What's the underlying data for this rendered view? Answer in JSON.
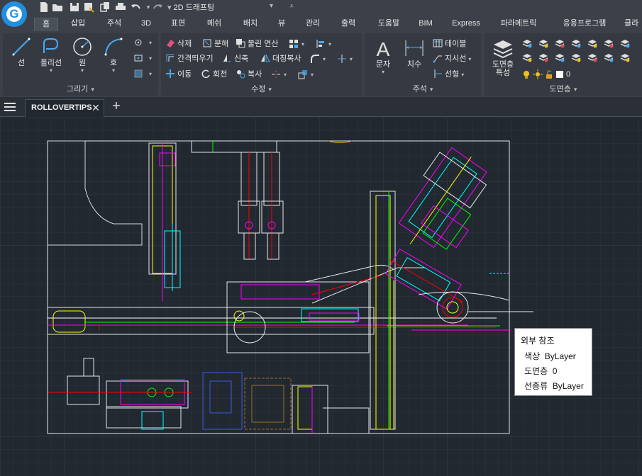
{
  "quick_access": {
    "workspace": "2D 드래프팅",
    "icons": [
      "new-file-icon",
      "open-folder-icon",
      "save-icon",
      "save-as-icon",
      "copy-icon",
      "print-icon",
      "undo-icon",
      "redo-icon"
    ]
  },
  "ribbon_tabs": [
    "홈",
    "삽입",
    "주석",
    "3D",
    "표면",
    "메쉬",
    "배치",
    "뷰",
    "관리",
    "출력",
    "도움말",
    "BIM",
    "Express",
    "파라메트릭",
    "응용프로그램",
    "클라"
  ],
  "active_tab": "홈",
  "panels": {
    "draw": {
      "title": "그리기",
      "line": "선",
      "polyline": "폴리선",
      "circle": "원",
      "arc": "호"
    },
    "modify": {
      "title": "수정",
      "erase": "삭제",
      "explode": "분해",
      "boolean": "불린 연산",
      "offset": "간격띄우기",
      "stretch": "신축",
      "mirror": "대칭복사",
      "move": "이동",
      "rotate": "회전",
      "copy": "복사"
    },
    "annotation": {
      "title": "주석",
      "text": "문자",
      "dimension": "치수",
      "table": "테이블",
      "leader": "지시선",
      "linetype": "선형"
    },
    "layers": {
      "title": "도면층",
      "properties": "도면층\n특성",
      "current_layer": "0"
    }
  },
  "document": {
    "tab_name": "ROLLOVERTIPS"
  },
  "tooltip": {
    "title": "외부 참조",
    "rows": [
      {
        "label": "색상",
        "value": "ByLayer"
      },
      {
        "label": "도면층",
        "value": "0"
      },
      {
        "label": "선종류",
        "value": "ByLayer"
      }
    ]
  },
  "colors": {
    "accent": "#1f8fe0",
    "canvas_bg": "#212830",
    "ribbon_bg": "#3b4049",
    "cad_white": "#ffffff",
    "cad_magenta": "#ff00ff",
    "cad_cyan": "#00ffff",
    "cad_yellow": "#ffff00",
    "cad_red": "#ff0000",
    "cad_green": "#00ff00"
  }
}
